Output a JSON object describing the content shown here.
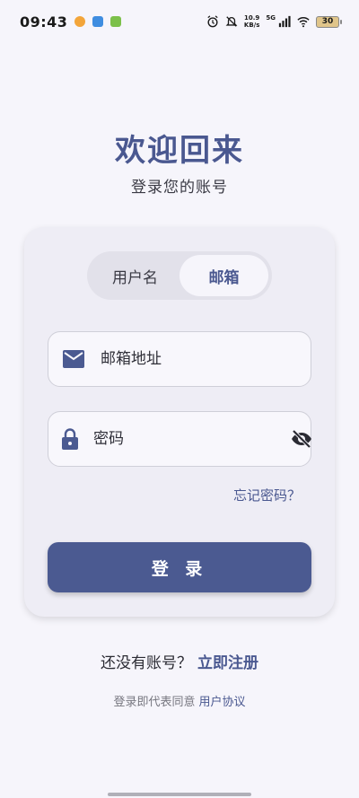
{
  "status_bar": {
    "time": "09:43",
    "app_icons": [
      "cat-app-icon",
      "message-app-icon",
      "frog-app-icon"
    ],
    "net_speed_value": "10.9",
    "net_speed_unit": "KB/s",
    "network": "5G",
    "battery": "30"
  },
  "header": {
    "title": "欢迎回来",
    "subtitle": "登录您的账号"
  },
  "login_mode": {
    "tabs": [
      {
        "label": "用户名",
        "active": false
      },
      {
        "label": "邮箱",
        "active": true
      }
    ]
  },
  "form": {
    "email_placeholder": "邮箱地址",
    "password_placeholder": "密码",
    "forgot_password": "忘记密码？",
    "submit_label": "登 录"
  },
  "footer": {
    "no_account_text": "还没有账号？",
    "register_link": "立即注册",
    "agreement_text": "登录即代表同意",
    "agreement_link": "用户协议"
  },
  "colors": {
    "accent": "#4b5a91",
    "background": "#f6f5fb",
    "card": "#eeedf5"
  }
}
